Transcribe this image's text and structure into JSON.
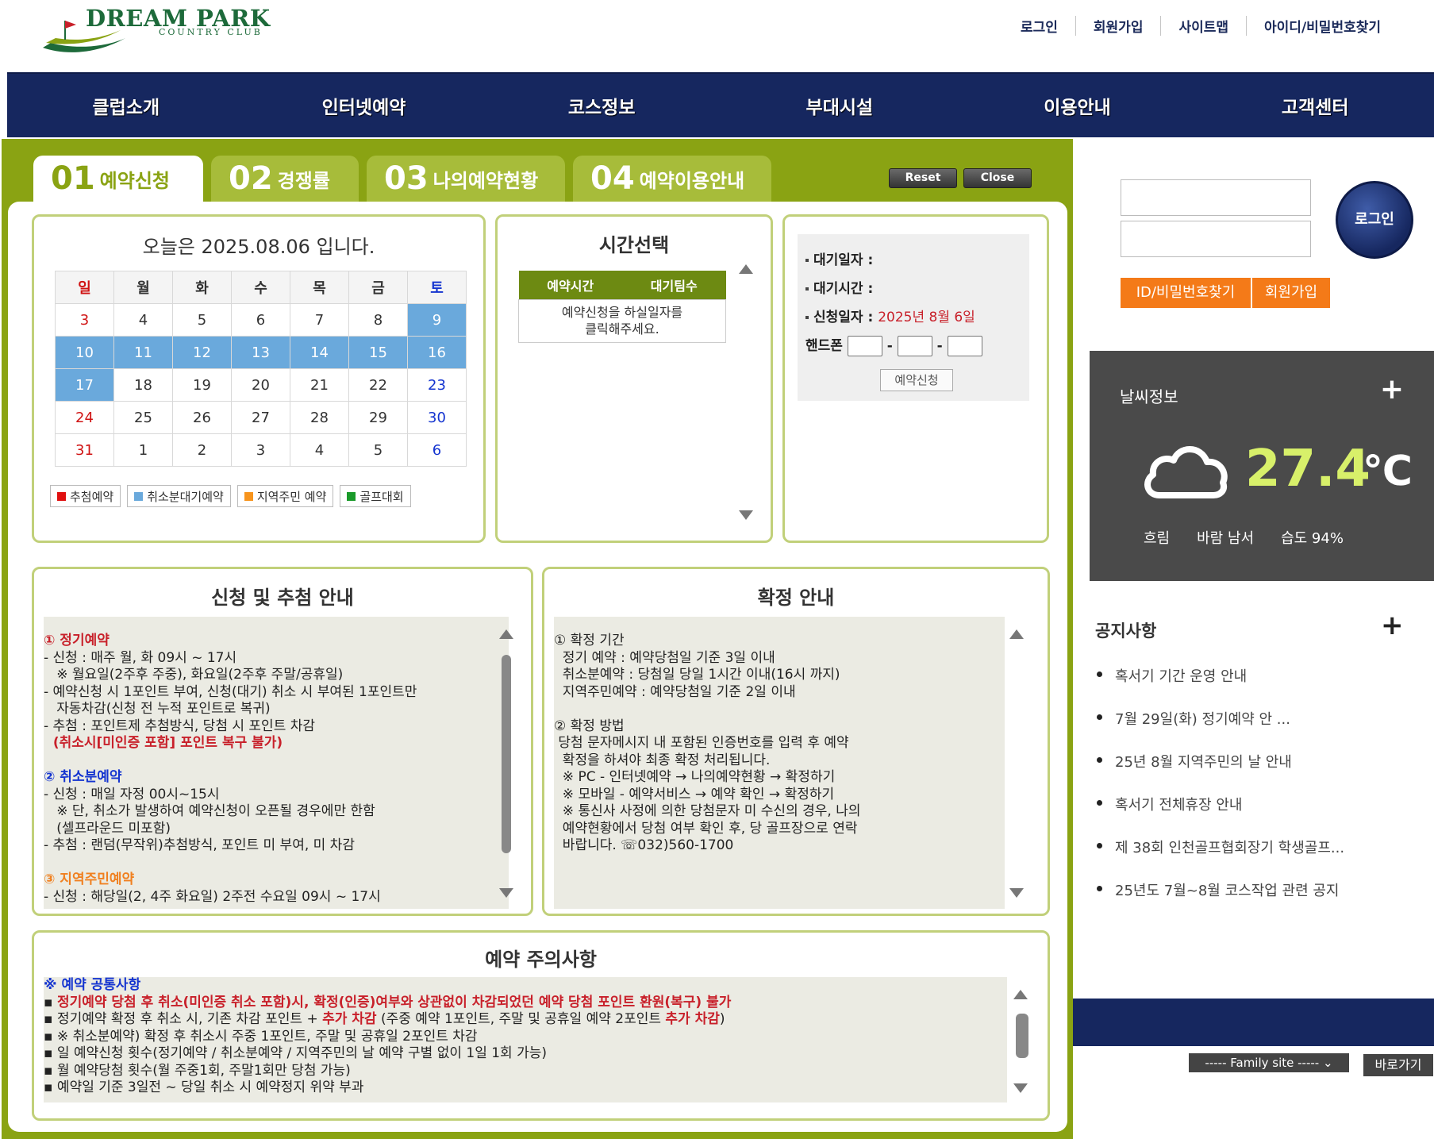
{
  "header": {
    "logo_title": "DREAM PARK",
    "logo_sub": "COUNTRY CLUB",
    "top_links": [
      "로그인",
      "회원가입",
      "사이트맵",
      "아이디/비밀번호찾기"
    ]
  },
  "nav": [
    "클럽소개",
    "인터넷예약",
    "코스정보",
    "부대시설",
    "이용안내",
    "고객센터"
  ],
  "tabs": [
    {
      "num": "01",
      "label": "예약신청"
    },
    {
      "num": "02",
      "label": "경쟁률"
    },
    {
      "num": "03",
      "label": "나의예약현황"
    },
    {
      "num": "04",
      "label": "예약이용안내"
    }
  ],
  "buttons": {
    "reset": "Reset",
    "close": "Close"
  },
  "calendar": {
    "today_text": "오늘은 2025.08.06 입니다.",
    "weekdays": [
      "일",
      "월",
      "화",
      "수",
      "목",
      "금",
      "토"
    ],
    "weeks": [
      [
        "3",
        "4",
        "5",
        "6",
        "7",
        "8",
        "9"
      ],
      [
        "10",
        "11",
        "12",
        "13",
        "14",
        "15",
        "16"
      ],
      [
        "17",
        "18",
        "19",
        "20",
        "21",
        "22",
        "23"
      ],
      [
        "24",
        "25",
        "26",
        "27",
        "28",
        "29",
        "30"
      ],
      [
        "31",
        "1",
        "2",
        "3",
        "4",
        "5",
        "6"
      ]
    ],
    "legend": [
      "추첨예약",
      "취소분대기예약",
      "지역주민 예약",
      "골프대회"
    ],
    "legend_colors": [
      "#e01010",
      "#6aa9dc",
      "#f7941d",
      "#1a9a2a"
    ]
  },
  "time_select": {
    "title": "시간선택",
    "col_time": "예약시간",
    "col_wait": "대기팀수",
    "message_line1": "예약신청을 하실일자를",
    "message_line2": "클릭해주세요."
  },
  "waiting_form": {
    "date_label": "대기일자 :",
    "time_label": "대기시간 :",
    "apply_date_label": "신청일자 :",
    "apply_date_value": "2025년 8월 6일",
    "phone_label": "핸드폰",
    "dash": "-",
    "submit": "예약신청"
  },
  "apply_info": {
    "title": "신청 및 추첨 안내",
    "lines": [
      {
        "t": "① 정기예약",
        "c": "red"
      },
      {
        "t": "- 신청 : 매주 월, 화 09시 ~ 17시",
        "c": ""
      },
      {
        "t": "   ※ 월요일(2주후 주중), 화요일(2주후 주말/공휴일)",
        "c": ""
      },
      {
        "t": "- 예약신청 시 1포인트 부여, 신청(대기) 취소 시 부여된 1포인트만",
        "c": ""
      },
      {
        "t": "   자동차감(신청 전 누적 포인트로 복귀)",
        "c": ""
      },
      {
        "t": "- 추첨 : 포인트제 추첨방식, 당첨 시 포인트 차감",
        "c": ""
      },
      {
        "t": "  (취소시[미인증 포함] 포인트 복구 불가)",
        "c": "red"
      },
      {
        "t": "",
        "c": ""
      },
      {
        "t": "② 취소분예약",
        "c": "blu"
      },
      {
        "t": "- 신청 : 매일 자정 00시~15시",
        "c": ""
      },
      {
        "t": "   ※ 단, 취소가 발생하여 예약신청이 오픈될 경우에만 한함",
        "c": ""
      },
      {
        "t": "   (셀프라운드 미포함)",
        "c": ""
      },
      {
        "t": "- 추첨 : 랜덤(무작위)추첨방식, 포인트 미 부여, 미 차감",
        "c": ""
      },
      {
        "t": "",
        "c": ""
      },
      {
        "t": "③ 지역주민예약",
        "c": "org"
      },
      {
        "t": "- 신청 : 해당일(2, 4주 화요일) 2주전 수요일 09시 ~ 17시",
        "c": ""
      }
    ]
  },
  "confirm_info": {
    "title": "확정 안내",
    "lines": [
      "① 확정 기간",
      "  정기 예약 : 예약당첨일 기준 3일 이내",
      "  취소분예약 : 당첨일 당일 1시간 이내(16시 까지)",
      "  지역주민예약 : 예약당첨일 기준 2일 이내",
      "",
      "② 확정 방법",
      " 당첨 문자메시지 내 포함된 인증번호를 입력 후 예약",
      "  확정을 하셔야 최종 확정 처리됩니다.",
      "  ※ PC - 인터넷예약 → 나의예약현황 → 확정하기",
      "  ※ 모바일 - 예약서비스 → 예약 확인 → 확정하기",
      "  ※ 통신사 사정에 의한 당첨문자 미 수신의 경우, 나의",
      "  예약현황에서 당첨 여부 확인 후, 당 골프장으로 연락",
      "  바랍니다. ☏032)560-1700"
    ]
  },
  "caution": {
    "title": "예약 주의사항",
    "lines": [
      [
        {
          "t": "※ 예약 공통사항",
          "c": "blu"
        }
      ],
      [
        {
          "t": "▪ ",
          "c": ""
        },
        {
          "t": "정기예약 당첨 후 취소(미인증 취소 포함)시, 확정(인증)여부와 상관없이 차감되었던 예약 당첨 포인트 환원(복구) 불가",
          "c": "red"
        }
      ],
      [
        {
          "t": "▪ 정기예약 확정 후 취소 시, 기존 차감 포인트 + ",
          "c": ""
        },
        {
          "t": "추가 차감",
          "c": "red"
        },
        {
          "t": " (주중 예약 1포인트, 주말 및 공휴일 예약 2포인트 ",
          "c": ""
        },
        {
          "t": "추가 차감",
          "c": "red"
        },
        {
          "t": ")",
          "c": ""
        }
      ],
      [
        {
          "t": "▪ ※ 취소분예약) 확정 후 취소시 주중 1포인트, 주말 및 공휴일 2포인트 차감",
          "c": ""
        }
      ],
      [
        {
          "t": "▪ 일 예약신청 횟수(정기예약 / 취소분예약 / 지역주민의 날 예약 구별 없이 1일 1회 가능)",
          "c": ""
        }
      ],
      [
        {
          "t": "▪ 월 예약당첨 횟수(월 주중1회, 주말1회만 당첨 가능)",
          "c": ""
        }
      ],
      [
        {
          "t": "▪ 예약일 기준 3일전 ~ 당일 취소 시 예약정지 위약 부과",
          "c": ""
        }
      ]
    ]
  },
  "sidebar": {
    "login_button": "로그인",
    "find_button": "ID/비밀번호찾기",
    "join_button": "회원가입",
    "weather": {
      "title": "날씨정보",
      "temp": "27.4",
      "unit": "℃",
      "condition": "흐림",
      "wind": "바람 남서",
      "humidity": "습도 94%"
    },
    "notice": {
      "title": "공지사항",
      "items": [
        "혹서기 기간 운영 안내",
        "7월 29일(화) 정기예약 안 ...",
        "25년 8월 지역주민의 날 안내",
        "혹서기 전체휴장 안내",
        "제 38회 인천골프협회장기 학생골프...",
        "25년도 7월~8월 코스작업 관련 공지"
      ]
    },
    "family_site": "----- Family site -----",
    "go_button": "바로가기"
  }
}
